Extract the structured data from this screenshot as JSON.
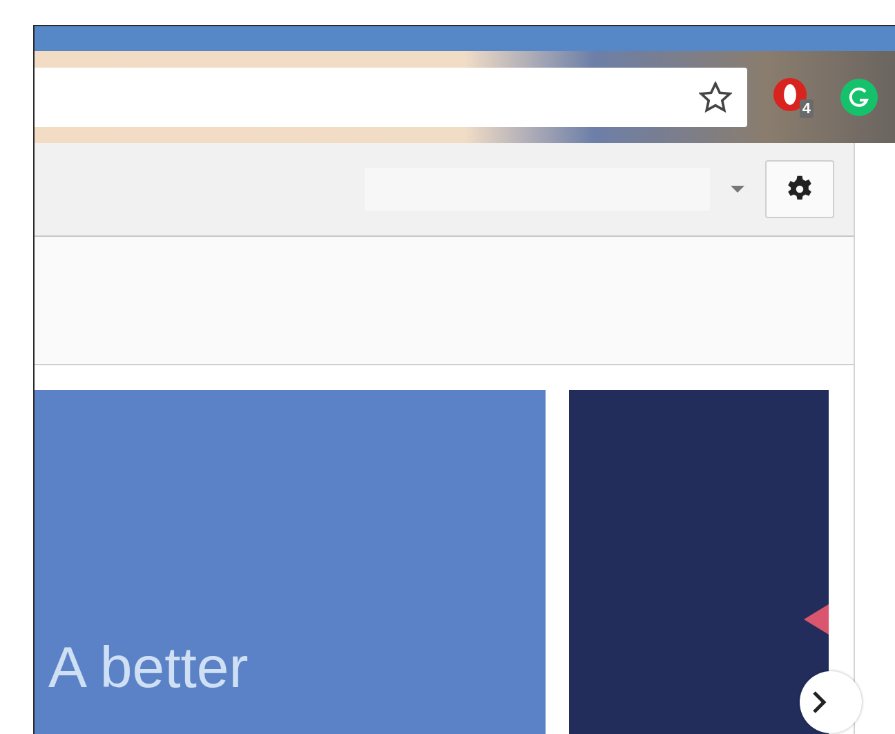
{
  "browser": {
    "extension_badge": "4"
  },
  "promo": {
    "headline": "A better"
  }
}
